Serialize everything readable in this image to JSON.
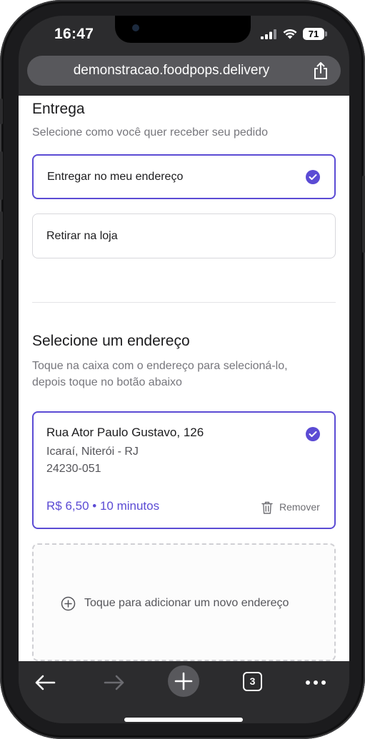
{
  "status_bar": {
    "time": "16:47",
    "battery": "71",
    "icons": [
      "cellular-signal-icon",
      "wifi-icon",
      "battery-icon"
    ]
  },
  "browser": {
    "url": "demonstracao.foodpops.delivery",
    "icons": [
      "share-icon",
      "back-arrow-icon",
      "forward-arrow-icon",
      "new-tab-plus-icon",
      "tabs-icon",
      "more-icon"
    ],
    "tab_count": "3"
  },
  "delivery": {
    "title": "Entrega",
    "subtitle": "Selecione como você quer receber seu pedido",
    "options": [
      {
        "label": "Entregar no meu endereço",
        "selected": true
      },
      {
        "label": "Retirar na loja",
        "selected": false
      }
    ]
  },
  "address_section": {
    "title": "Selecione um endereço",
    "subtitle_line1": "Toque na caixa com o endereço para selecioná-lo,",
    "subtitle_line2": "depois toque no botão abaixo",
    "address": {
      "street": "Rua Ator Paulo Gustavo, 126",
      "neighborhood": "Icaraí, Niterói - RJ",
      "zip": "24230-051",
      "price_time": "R$ 6,50 • 10 minutos",
      "remove_label": "Remover",
      "selected": true
    },
    "add_new_label": "Toque para adicionar um novo endereço"
  },
  "colors": {
    "accent": "#5b4bd4",
    "browser_chrome": "#2c2c2e"
  }
}
